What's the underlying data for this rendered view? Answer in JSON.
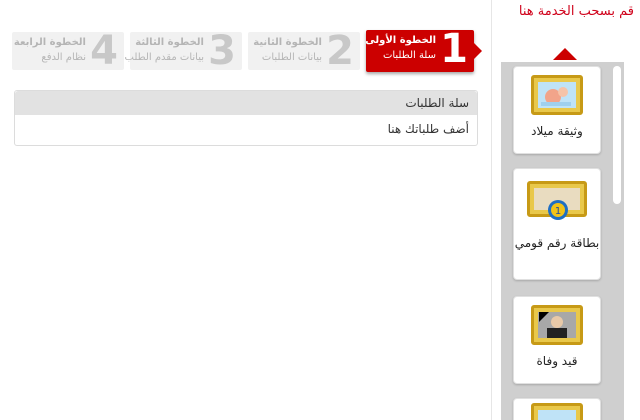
{
  "hint": "قم بسحب الخدمة هنا",
  "steps": [
    {
      "number": "1",
      "title": "الخطوة الأولى",
      "subtitle": "سلة الطلبات",
      "active": true
    },
    {
      "number": "2",
      "title": "الخطوة الثانية",
      "subtitle": "بيانات الطلبات",
      "active": false
    },
    {
      "number": "3",
      "title": "الخطوة الثالثة",
      "subtitle": "بيانات مقدم الطلب",
      "active": false
    },
    {
      "number": "4",
      "title": "الخطوة الرابعة",
      "subtitle": "نظام الدفع",
      "active": false
    }
  ],
  "cart": {
    "title": "سلة الطلبات",
    "placeholder": "أضف طلباتك هنا"
  },
  "services": [
    {
      "label": "وثيقة ميلاد",
      "icon": "birth-certificate-icon"
    },
    {
      "label": "بطاقة رقم قومي",
      "icon": "national-id-icon"
    },
    {
      "label": "قيد وفاة",
      "icon": "death-record-icon"
    }
  ],
  "colors": {
    "accent": "#cc0000",
    "hint": "#d0021b",
    "frame": "#e9c84a"
  }
}
